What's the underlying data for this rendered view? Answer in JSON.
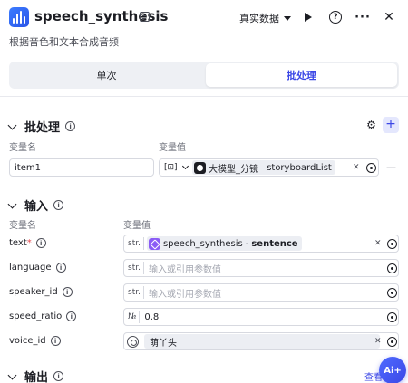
{
  "header": {
    "title": "speech_synthesis",
    "subtitle": "根据音色和文本合成音频",
    "data_mode": "真实数据"
  },
  "tabs": [
    {
      "label": "单次",
      "active": false
    },
    {
      "label": "批处理",
      "active": true
    }
  ],
  "batch": {
    "title": "批处理",
    "col_name": "变量名",
    "col_value": "变量值",
    "row": {
      "name": "item1",
      "type_icon": "[⊡]",
      "node": "大模型_分镜",
      "variable": "storyboardList"
    }
  },
  "input": {
    "title": "输入",
    "col_name": "变量名",
    "col_value": "变量值",
    "params": [
      {
        "name": "text",
        "required": "*",
        "type": "str.",
        "node": "speech_synthesis",
        "sep": "-",
        "variable": "sentence"
      },
      {
        "name": "language",
        "type": "str.",
        "placeholder": "输入或引用参数值"
      },
      {
        "name": "speaker_id",
        "type": "str.",
        "placeholder": "输入或引用参数值"
      },
      {
        "name": "speed_ratio",
        "type": "№",
        "value": "0.8"
      },
      {
        "name": "voice_id",
        "value": "萌丫头"
      }
    ]
  },
  "output": {
    "title": "输出",
    "link": "查看"
  },
  "fab": {
    "label": "Ai+"
  },
  "colors": {
    "accent": "#3b47e6",
    "required": "#e5484d",
    "chip_purple": "#8b5cf6"
  }
}
